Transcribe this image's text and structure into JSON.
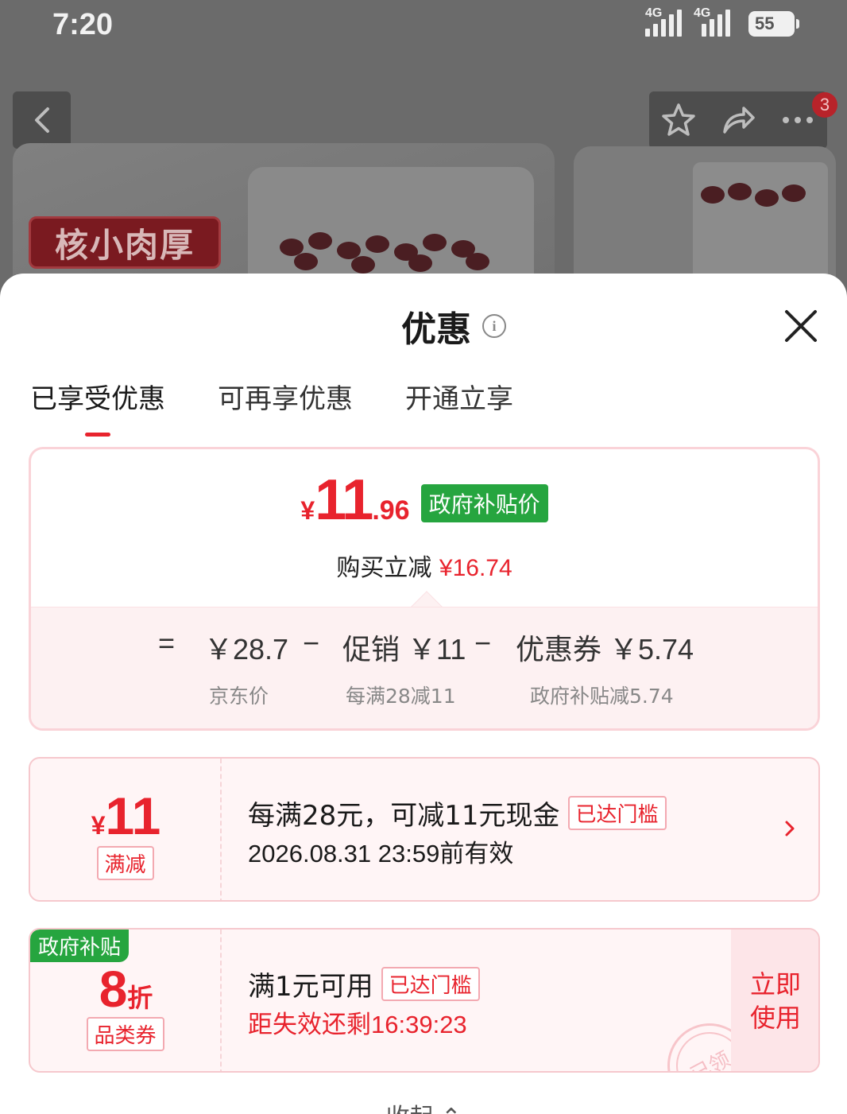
{
  "status_bar": {
    "time": "7:20",
    "network_1": "4G",
    "network_2": "4G",
    "battery": "55"
  },
  "background": {
    "product_tag": "核小肉厚",
    "cart_badge": "3",
    "icons": [
      "back-arrow-icon",
      "star-icon",
      "share-icon",
      "more-icon"
    ]
  },
  "sheet": {
    "title": "优惠",
    "tabs": [
      "已享受优惠",
      "可再享优惠",
      "开通立享"
    ],
    "active_tab": 0,
    "summary": {
      "price_currency": "¥",
      "price_int": "11",
      "price_dec": ".96",
      "price_tag": "政府补贴价",
      "reduce_label": "购买立减",
      "reduce_amount": "¥16.74",
      "calc": {
        "equals": "=",
        "jd_price": "￥28.7",
        "minus_1": "−",
        "promo": "促销 ￥11",
        "minus_2": "−",
        "coupon": "优惠券 ￥5.74",
        "jd_price_label": "京东价",
        "promo_label": "每满28减11",
        "coupon_label": "政府补贴减5.74"
      }
    },
    "coupons": [
      {
        "currency": "¥",
        "amount": "11",
        "type": "满减",
        "title": "每满28元，可减11元现金",
        "threshold": "已达门槛",
        "validity": "2026.08.31 23:59前有效"
      },
      {
        "corner_tag": "政府补贴",
        "amount": "8",
        "unit": "折",
        "type": "品类券",
        "title": "满1元可用",
        "threshold": "已达门槛",
        "countdown": "距失效还剩16:39:23",
        "use_line1": "立即",
        "use_line2": "使用",
        "stamp": "已领"
      }
    ],
    "collapse": "收起"
  },
  "colors": {
    "accent_red": "#e8232d",
    "gov_green": "#26a53f",
    "coupon_bg": "#fff5f6"
  }
}
